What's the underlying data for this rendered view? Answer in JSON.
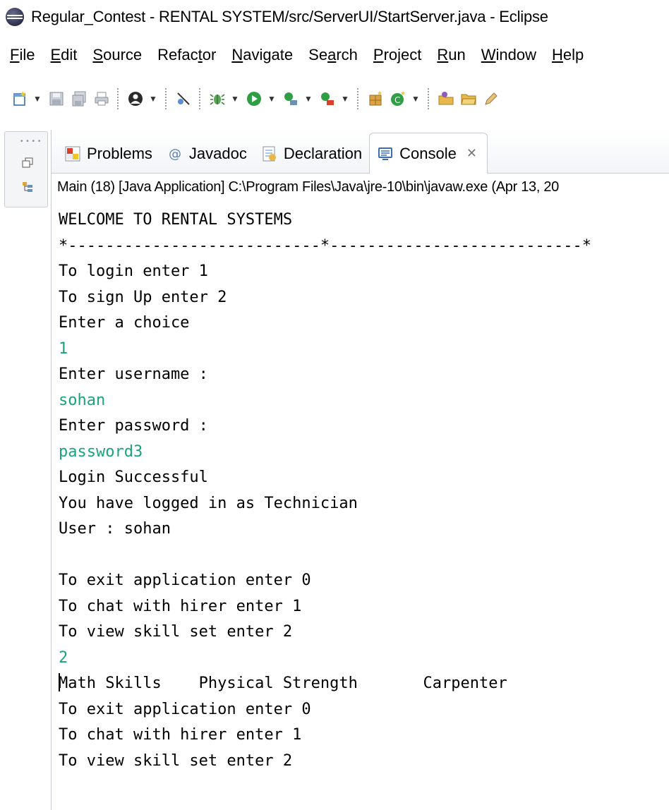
{
  "window": {
    "title": "Regular_Contest - RENTAL SYSTEM/src/ServerUI/StartServer.java - Eclipse"
  },
  "menu": [
    {
      "pre": "",
      "mn": "F",
      "post": "ile"
    },
    {
      "pre": "",
      "mn": "E",
      "post": "dit"
    },
    {
      "pre": "",
      "mn": "S",
      "post": "ource"
    },
    {
      "pre": "Refac",
      "mn": "t",
      "post": "or"
    },
    {
      "pre": "",
      "mn": "N",
      "post": "avigate"
    },
    {
      "pre": "Se",
      "mn": "a",
      "post": "rch"
    },
    {
      "pre": "",
      "mn": "P",
      "post": "roject"
    },
    {
      "pre": "",
      "mn": "R",
      "post": "un"
    },
    {
      "pre": "",
      "mn": "W",
      "post": "indow"
    },
    {
      "pre": "",
      "mn": "H",
      "post": "elp"
    }
  ],
  "tabs": [
    {
      "label": "Problems",
      "icon": "problems-icon"
    },
    {
      "label": "Javadoc",
      "icon": "javadoc-icon"
    },
    {
      "label": "Declaration",
      "icon": "declaration-icon"
    },
    {
      "label": "Console",
      "icon": "console-icon",
      "active": true,
      "close": "✕"
    }
  ],
  "console": {
    "header": "Main (18) [Java Application] C:\\Program Files\\Java\\jre-10\\bin\\javaw.exe (Apr 13, 20",
    "lines": [
      {
        "text": "WELCOME TO RENTAL SYSTEMS",
        "type": "out"
      },
      {
        "text": "*---------------------------*---------------------------*",
        "type": "out"
      },
      {
        "text": "To login enter 1",
        "type": "out"
      },
      {
        "text": "To sign Up enter 2",
        "type": "out"
      },
      {
        "text": "Enter a choice",
        "type": "out"
      },
      {
        "text": "1",
        "type": "input"
      },
      {
        "text": "Enter username :",
        "type": "out"
      },
      {
        "text": "sohan",
        "type": "input"
      },
      {
        "text": "Enter password :",
        "type": "out"
      },
      {
        "text": "password3",
        "type": "input"
      },
      {
        "text": "Login Successful",
        "type": "out"
      },
      {
        "text": "You have logged in as Technician",
        "type": "out"
      },
      {
        "text": "User : sohan",
        "type": "out"
      },
      {
        "text": "",
        "type": "out"
      },
      {
        "text": "To exit application enter 0",
        "type": "out"
      },
      {
        "text": "To chat with hirer enter 1",
        "type": "out"
      },
      {
        "text": "To view skill set enter 2",
        "type": "out"
      },
      {
        "text": "2",
        "type": "input"
      },
      {
        "text": "Math Skills    Physical Strength       Carpenter",
        "type": "out",
        "caret": true
      },
      {
        "text": "To exit application enter 0",
        "type": "out"
      },
      {
        "text": "To chat with hirer enter 1",
        "type": "out"
      },
      {
        "text": "To view skill set enter 2",
        "type": "out"
      }
    ]
  },
  "colors": {
    "input_text": "#1aa37f",
    "border": "#c8ccd2"
  }
}
